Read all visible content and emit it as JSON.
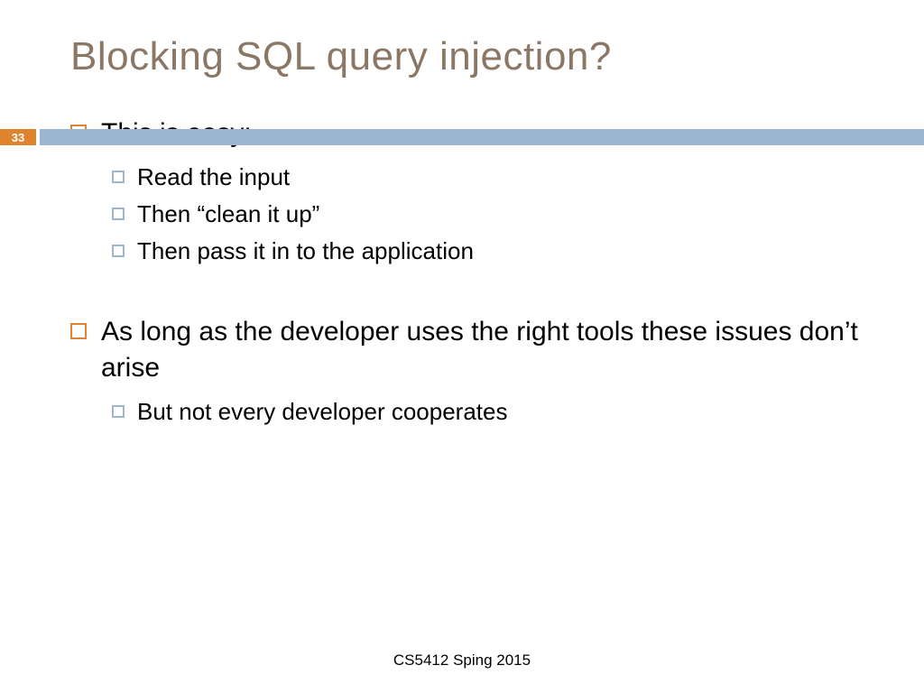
{
  "title": "Blocking SQL query injection?",
  "page_number": "33",
  "bullets": {
    "item1": {
      "text": "This is easy:"
    },
    "item1_1": {
      "text": "Read the input"
    },
    "item1_2": {
      "text": "Then “clean it up”"
    },
    "item1_3": {
      "text": "Then pass it in to the application"
    },
    "item2": {
      "text": "As long as the developer uses the right tools these issues don’t arise"
    },
    "item2_1": {
      "text": "But not every developer cooperates"
    }
  },
  "footer": "CS5412 Sping 2015"
}
